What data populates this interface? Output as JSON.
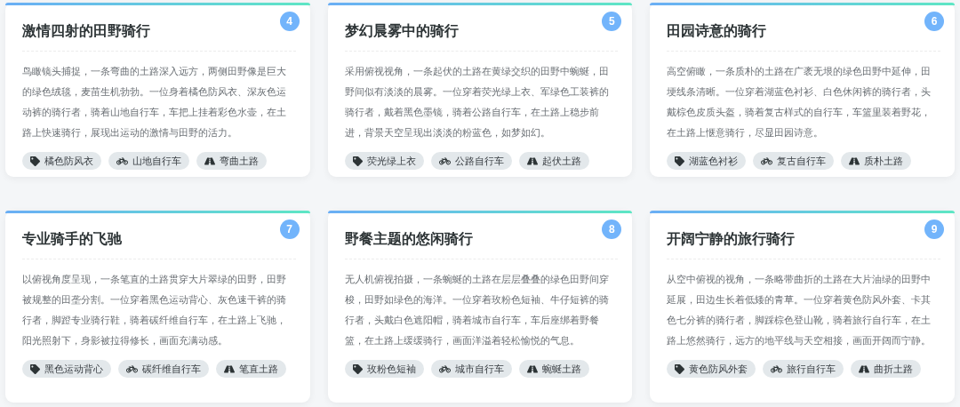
{
  "cards": [
    {
      "number": "4",
      "title": "激情四射的田野骑行",
      "description": "鸟瞰镜头捕捉，一条弯曲的土路深入远方，两侧田野像是巨大的绿色绒毯，麦苗生机勃勃。一位身着橘色防风衣、深灰色运动裤的骑行者，骑着山地自行车，车把上挂着彩色水壶，在土路上快速骑行，展现出运动的激情与田野的活力。",
      "tags": [
        {
          "kind": "tag",
          "label": "橘色防风衣"
        },
        {
          "kind": "bike",
          "label": "山地自行车"
        },
        {
          "kind": "road",
          "label": "弯曲土路"
        }
      ]
    },
    {
      "number": "5",
      "title": "梦幻晨雾中的骑行",
      "description": "采用俯视视角，一条起伏的土路在黄绿交织的田野中蜿蜒，田野间似有淡淡的晨雾。一位穿着荧光绿上衣、军绿色工装裤的骑行者，戴着黑色墨镜，骑着公路自行车，在土路上稳步前进，背景天空呈现出淡淡的粉蓝色，如梦如幻。",
      "tags": [
        {
          "kind": "tag",
          "label": "荧光绿上衣"
        },
        {
          "kind": "bike",
          "label": "公路自行车"
        },
        {
          "kind": "road",
          "label": "起伏土路"
        }
      ]
    },
    {
      "number": "6",
      "title": "田园诗意的骑行",
      "description": "高空俯瞰，一条质朴的土路在广袤无垠的绿色田野中延伸，田埂线条清晰。一位穿着湖蓝色衬衫、白色休闲裤的骑行者，头戴棕色皮质头盔，骑着复古样式的自行车，车篮里装着野花，在土路上惬意骑行，尽显田园诗意。",
      "tags": [
        {
          "kind": "tag",
          "label": "湖蓝色衬衫"
        },
        {
          "kind": "bike",
          "label": "复古自行车"
        },
        {
          "kind": "road",
          "label": "质朴土路"
        }
      ]
    },
    {
      "number": "7",
      "title": "专业骑手的飞驰",
      "description": "以俯视角度呈现，一条笔直的土路贯穿大片翠绿的田野，田野被规整的田垄分割。一位穿着黑色运动背心、灰色速干裤的骑行者，脚蹬专业骑行鞋，骑着碳纤维自行车，在土路上飞驰，阳光照射下，身影被拉得修长，画面充满动感。",
      "tags": [
        {
          "kind": "tag",
          "label": "黑色运动背心"
        },
        {
          "kind": "bike",
          "label": "碳纤维自行车"
        },
        {
          "kind": "road",
          "label": "笔直土路"
        }
      ]
    },
    {
      "number": "8",
      "title": "野餐主题的悠闲骑行",
      "description": "无人机俯视拍摄，一条蜿蜒的土路在层层叠叠的绿色田野间穿梭，田野如绿色的海洋。一位穿着玫粉色短袖、牛仔短裤的骑行者，头戴白色遮阳帽，骑着城市自行车，车后座绑着野餐篮，在土路上缓缓骑行，画面洋溢着轻松愉悦的气息。",
      "tags": [
        {
          "kind": "tag",
          "label": "玫粉色短袖"
        },
        {
          "kind": "bike",
          "label": "城市自行车"
        },
        {
          "kind": "road",
          "label": "蜿蜒土路"
        }
      ]
    },
    {
      "number": "9",
      "title": "开阔宁静的旅行骑行",
      "description": "从空中俯视的视角，一条略带曲折的土路在大片油绿的田野中延展，田边生长着低矮的青草。一位穿着黄色防风外套、卡其色七分裤的骑行者，脚踩棕色登山靴，骑着旅行自行车，在土路上悠然骑行，远方的地平线与天空相接，画面开阔而宁静。",
      "tags": [
        {
          "kind": "tag",
          "label": "黄色防风外套"
        },
        {
          "kind": "bike",
          "label": "旅行自行车"
        },
        {
          "kind": "road",
          "label": "曲折土路"
        }
      ]
    }
  ]
}
